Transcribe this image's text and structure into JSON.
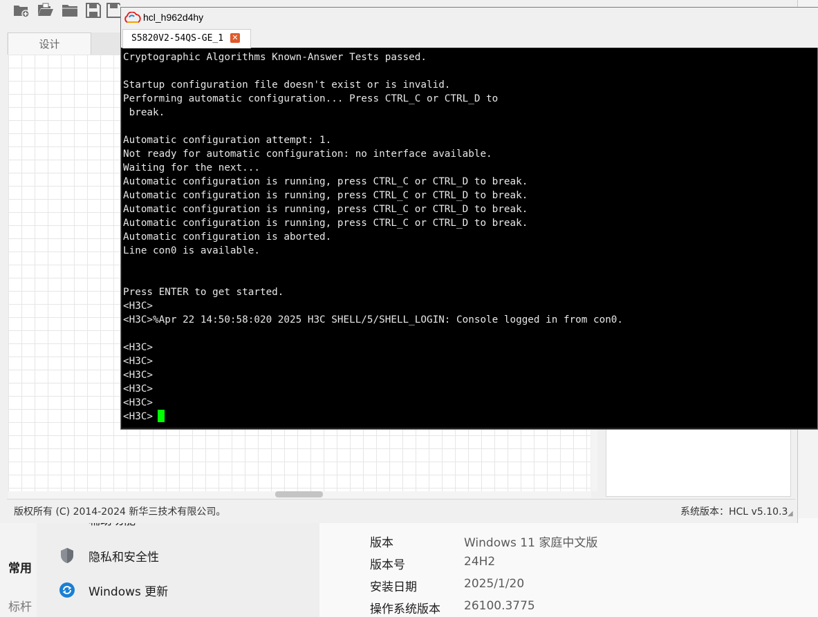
{
  "settings": {
    "partial_top_item": "辅助功能",
    "section_label_partial": "常用",
    "bottom_label_partial": "标杆",
    "nav_items": [
      {
        "label": "隐私和安全性",
        "icon": "shield-icon"
      },
      {
        "label": "Windows 更新",
        "icon": "windows-update-icon"
      }
    ],
    "specs": [
      {
        "label": "版本",
        "value": "Windows 11 家庭中文版"
      },
      {
        "label": "版本号",
        "value": "24H2"
      },
      {
        "label": "安装日期",
        "value": "2025/1/20"
      },
      {
        "label": "操作系统版本",
        "value": "26100.3775"
      }
    ]
  },
  "hcl": {
    "tab_design": "设计",
    "copyright": "版权所有 (C) 2014-2024 新华三技术有限公司。",
    "version": "系统版本：HCL v5.10.3",
    "toolbar_icons": [
      "new-project-icon",
      "open-project-icon",
      "folder-icon",
      "save-icon",
      "save-as-icon"
    ]
  },
  "terminal": {
    "title": "hcl_h962d4hy",
    "tab_label": "S5820V2-54QS-GE_1",
    "lines": [
      "Cryptographic Algorithms Known-Answer Tests passed.",
      "",
      "Startup configuration file doesn't exist or is invalid.",
      "Performing automatic configuration... Press CTRL_C or CTRL_D to",
      " break.",
      "",
      "Automatic configuration attempt: 1.",
      "Not ready for automatic configuration: no interface available.",
      "Waiting for the next...",
      "Automatic configuration is running, press CTRL_C or CTRL_D to break.",
      "Automatic configuration is running, press CTRL_C or CTRL_D to break.",
      "Automatic configuration is running, press CTRL_C or CTRL_D to break.",
      "Automatic configuration is running, press CTRL_C or CTRL_D to break.",
      "Automatic configuration is aborted.",
      "Line con0 is available.",
      "",
      "",
      "Press ENTER to get started.",
      "<H3C>",
      "<H3C>%Apr 22 14:50:58:020 2025 H3C SHELL/5/SHELL_LOGIN: Console logged in from con0.",
      "",
      "<H3C>",
      "<H3C>",
      "<H3C>",
      "<H3C>",
      "<H3C>",
      "<H3C>"
    ],
    "cursor_color": "#00ff00"
  }
}
